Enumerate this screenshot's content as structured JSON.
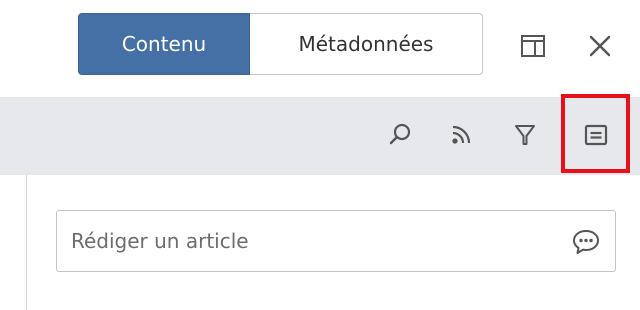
{
  "tabs": {
    "content_label": "Contenu",
    "metadata_label": "Métadonnées",
    "active": "content"
  },
  "window_controls": {
    "layout_icon": "panel-layout-icon",
    "close_icon": "close-icon"
  },
  "toolbar": {
    "search_icon": "search-icon",
    "feed_icon": "rss-feed-icon",
    "filter_icon": "filter-icon",
    "view_icon": "list-view-icon",
    "highlighted": "list-view-icon"
  },
  "compose": {
    "placeholder": "Rédiger un article",
    "value": "",
    "icon": "comment-icon"
  },
  "colors": {
    "accent": "#4470a6",
    "toolbar_bg": "#e7e8eb",
    "highlight": "#e8101b",
    "icon": "#555555"
  }
}
